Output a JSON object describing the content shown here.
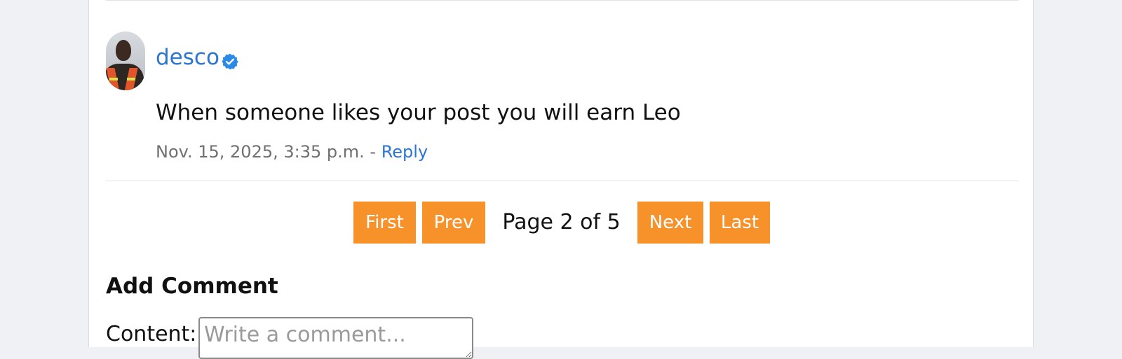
{
  "comment": {
    "username": "desco",
    "verified_icon": "verified-badge-icon",
    "avatar_icon": "user-avatar",
    "text": "When someone likes your post you will earn Leo",
    "timestamp": "Nov. 15, 2025, 3:35 p.m.",
    "separator": " - ",
    "reply_label": "Reply"
  },
  "pagination": {
    "first_label": "First",
    "prev_label": "Prev",
    "page_label": "Page 2 of 5",
    "next_label": "Next",
    "last_label": "Last"
  },
  "add_comment": {
    "title": "Add Comment",
    "content_label": "Content:",
    "content_placeholder": "Write a comment..."
  },
  "colors": {
    "link": "#2a76d2",
    "button_bg": "#f7912a",
    "button_text": "#ffffff",
    "page_bg": "#f0f1f4",
    "card_bg": "#ffffff"
  }
}
